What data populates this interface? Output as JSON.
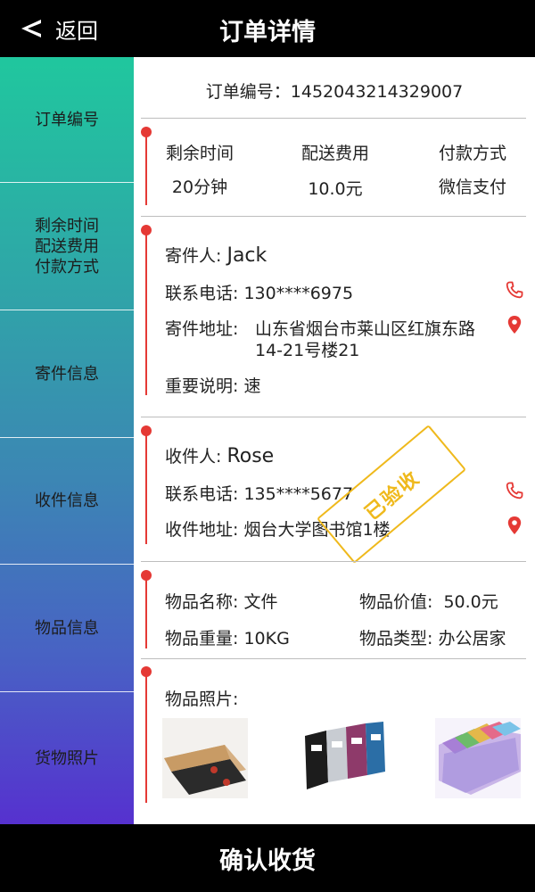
{
  "header": {
    "back_label": "返回",
    "title": "订单详情"
  },
  "sidebar": {
    "items": [
      {
        "label": "订单编号"
      },
      {
        "label_lines": [
          "剩余时间",
          "配送费用",
          "付款方式"
        ]
      },
      {
        "label": "寄件信息"
      },
      {
        "label": "收件信息"
      },
      {
        "label": "物品信息"
      },
      {
        "label": "货物照片"
      }
    ]
  },
  "order": {
    "number_label": "订单编号：",
    "number": "1452043214329007"
  },
  "summary": {
    "remaining_time_label": "剩余时间",
    "remaining_time": "20分钟",
    "delivery_fee_label": "配送费用",
    "delivery_fee": "10.0元",
    "payment_label": "付款方式",
    "payment": "微信支付"
  },
  "sender": {
    "name_label": "寄件人:",
    "name": "Jack",
    "phone_label": "联系电话:",
    "phone": "130****6975",
    "address_label": "寄件地址:",
    "address_line1": "山东省烟台市莱山区红旗东路",
    "address_line2": "14-21号楼21",
    "note_label": "重要说明:",
    "note": "速"
  },
  "receiver": {
    "name_label": "收件人:",
    "name": "Rose",
    "phone_label": "联系电话:",
    "phone": "135****5677",
    "address_label": "收件地址:",
    "address": "烟台大学图书馆1楼",
    "stamp": "已验收"
  },
  "item": {
    "name_label": "物品名称:",
    "name": "文件",
    "value_label": "物品价值:",
    "value": "50.0元",
    "weight_label": "物品重量:",
    "weight": "10KG",
    "type_label": "物品类型:",
    "type": "办公居家"
  },
  "photos": {
    "label": "物品照片:"
  },
  "footer": {
    "confirm_label": "确认收货"
  },
  "colors": {
    "accent_red": "#e53935",
    "stamp_yellow": "#efb91c",
    "bar_black": "#000000"
  },
  "icons": [
    "back-arrow-icon",
    "phone-icon",
    "location-pin-icon"
  ]
}
